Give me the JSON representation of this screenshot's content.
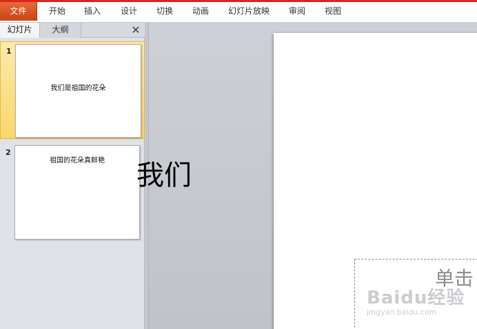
{
  "ribbon": {
    "file": "文件",
    "tabs": [
      "开始",
      "插入",
      "设计",
      "切换",
      "动画",
      "幻灯片放映",
      "审阅",
      "视图"
    ]
  },
  "pane": {
    "tabs": [
      "幻灯片",
      "大纲"
    ],
    "close": "✕"
  },
  "slides": [
    {
      "number": "1",
      "title": "我们是祖国的花朵",
      "selected": true
    },
    {
      "number": "2",
      "title": "祖国的花朵真鲜艳",
      "selected": false
    }
  ],
  "editor": {
    "title_visible": "我们",
    "subtitle_placeholder_visible": "单击"
  },
  "watermark": {
    "brand": "Baidu经验",
    "url": "jingyan.baidu.com"
  },
  "colors": {
    "accent": "#d8271c",
    "file_tab": "#d9561f",
    "selected_thumb": "#fbd66a"
  }
}
